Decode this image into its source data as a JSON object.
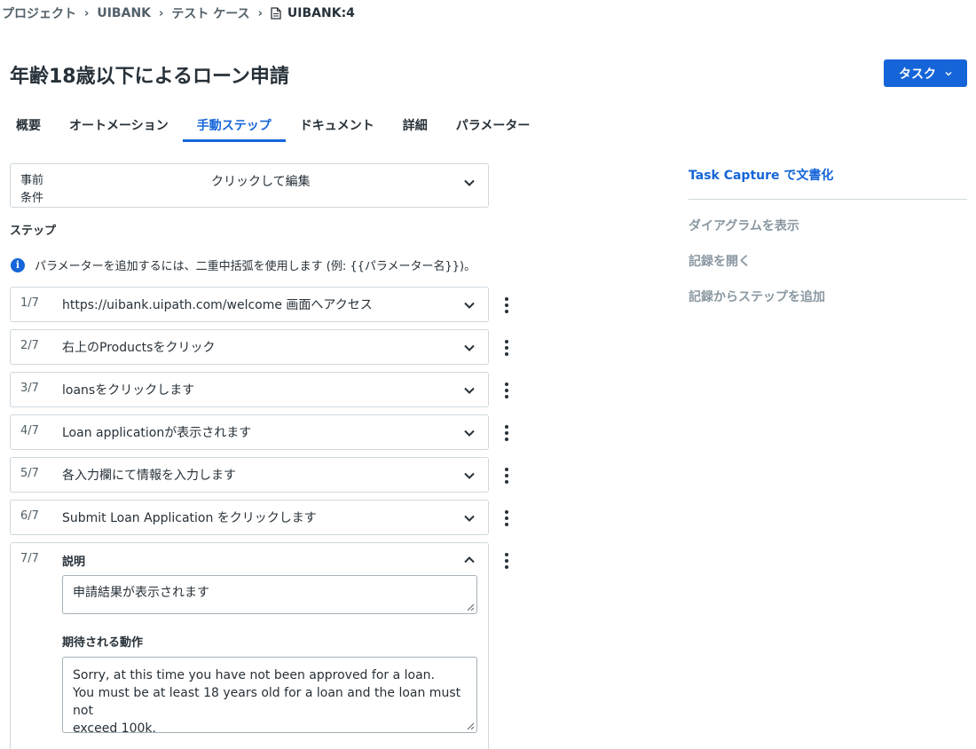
{
  "breadcrumb": {
    "items": [
      "プロジェクト",
      "UIBANK",
      "テスト ケース"
    ],
    "current": "UIBANK:4"
  },
  "page": {
    "title": "年齢18歳以下によるローン申請"
  },
  "task_button": {
    "label": "タスク"
  },
  "tabs": [
    "概要",
    "オートメーション",
    "手動ステップ",
    "ドキュメント",
    "詳細",
    "パラメーター"
  ],
  "active_tab": "手動ステップ",
  "precondition": {
    "label": "事前条件",
    "value": "クリックして編集"
  },
  "steps_section": {
    "label": "ステップ",
    "info": "パラメーターを追加するには、二重中括弧を使用します (例: {{パラメーター名}})。"
  },
  "steps": [
    {
      "num": "1/7",
      "text": "https://uibank.uipath.com/welcome 画面へアクセス"
    },
    {
      "num": "2/7",
      "text": "右上のProductsをクリック"
    },
    {
      "num": "3/7",
      "text": "loansをクリックします"
    },
    {
      "num": "4/7",
      "text": "Loan applicationが表示されます"
    },
    {
      "num": "5/7",
      "text": "各入力欄にて情報を入力します"
    },
    {
      "num": "6/7",
      "text": "Submit Loan Application をクリックします"
    }
  ],
  "expanded_step": {
    "num": "7/7",
    "description_label": "説明",
    "description_value": "申請結果が表示されます",
    "expected_label": "期待される動作",
    "expected_value_line1": "Sorry, at this time you have not been approved for a loan.",
    "expected_value_line2": "You must be at least 18 years old for a loan and the loan must not",
    "expected_value_line3": "exceed 100k."
  },
  "sidebar": {
    "primary_link": "Task Capture で文書化",
    "links": [
      "ダイアグラムを表示",
      "記録を開く",
      "記録からステップを追加"
    ]
  },
  "colors": {
    "accent": "#1665d8",
    "text": "#273139",
    "muted": "#8a97a0",
    "border": "#cfd8dd"
  }
}
